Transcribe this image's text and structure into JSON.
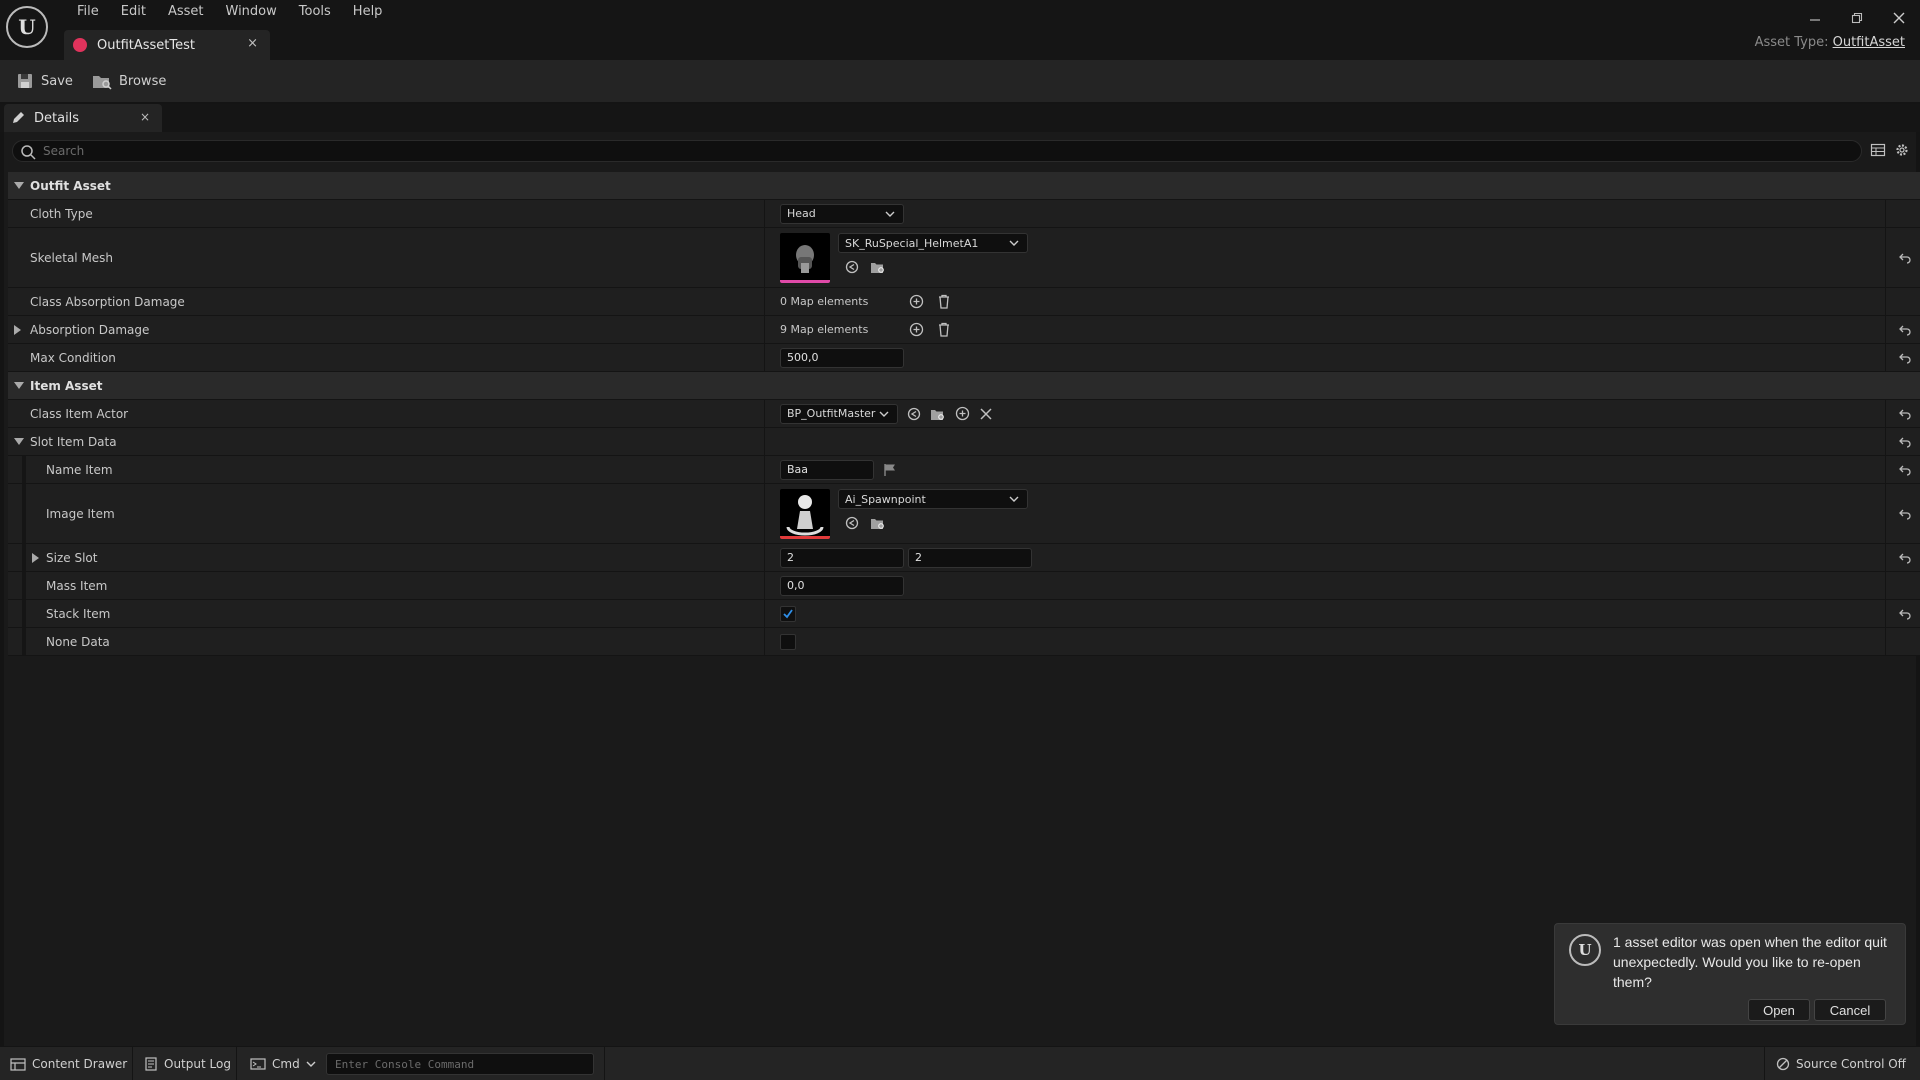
{
  "menu": [
    "File",
    "Edit",
    "Asset",
    "Window",
    "Tools",
    "Help"
  ],
  "tab": {
    "title": "OutfitAssetTest",
    "close": "×"
  },
  "asset_type": {
    "label": "Asset Type:",
    "value": "OutfitAsset"
  },
  "toolbar": {
    "save_label": "Save",
    "browse_label": "Browse"
  },
  "details": {
    "tab_label": "Details",
    "close": "×",
    "search_placeholder": "Search"
  },
  "sections": {
    "outfit_asset": "Outfit Asset",
    "item_asset": "Item Asset"
  },
  "properties": {
    "cloth_type": {
      "label": "Cloth Type",
      "value": "Head"
    },
    "skeletal_mesh": {
      "label": "Skeletal Mesh",
      "value": "SK_RuSpecial_HelmetA1"
    },
    "class_absorption_damage": {
      "label": "Class Absorption Damage",
      "value": "0 Map elements"
    },
    "absorption_damage": {
      "label": "Absorption Damage",
      "value": "9 Map elements"
    },
    "max_condition": {
      "label": "Max Condition",
      "value": "500,0"
    },
    "class_item_actor": {
      "label": "Class Item Actor",
      "value": "BP_OutfitMaster"
    },
    "slot_item_data": {
      "label": "Slot Item Data"
    },
    "name_item": {
      "label": "Name Item",
      "value": "Baa"
    },
    "image_item": {
      "label": "Image Item",
      "value": "Ai_Spawnpoint"
    },
    "size_slot": {
      "label": "Size Slot",
      "x": "2",
      "y": "2"
    },
    "mass_item": {
      "label": "Mass Item",
      "value": "0,0"
    },
    "stack_item": {
      "label": "Stack Item",
      "checked": true
    },
    "none_data": {
      "label": "None Data",
      "checked": false
    }
  },
  "notification": {
    "message": "1 asset editor was open when the editor quit unexpectedly. Would you like to re-open them?",
    "open_label": "Open",
    "cancel_label": "Cancel"
  },
  "statusbar": {
    "content_drawer": "Content Drawer",
    "output_log": "Output Log",
    "cmd": "Cmd",
    "console_placeholder": "Enter Console Command",
    "source_control": "Source Control Off"
  },
  "colors": {
    "tab_dot": "#e0335c",
    "skeletal_thumb_bar": "#e04aa8",
    "texture_thumb_bar": "#e03a3a",
    "checkbox_check": "#2f8fe8"
  }
}
